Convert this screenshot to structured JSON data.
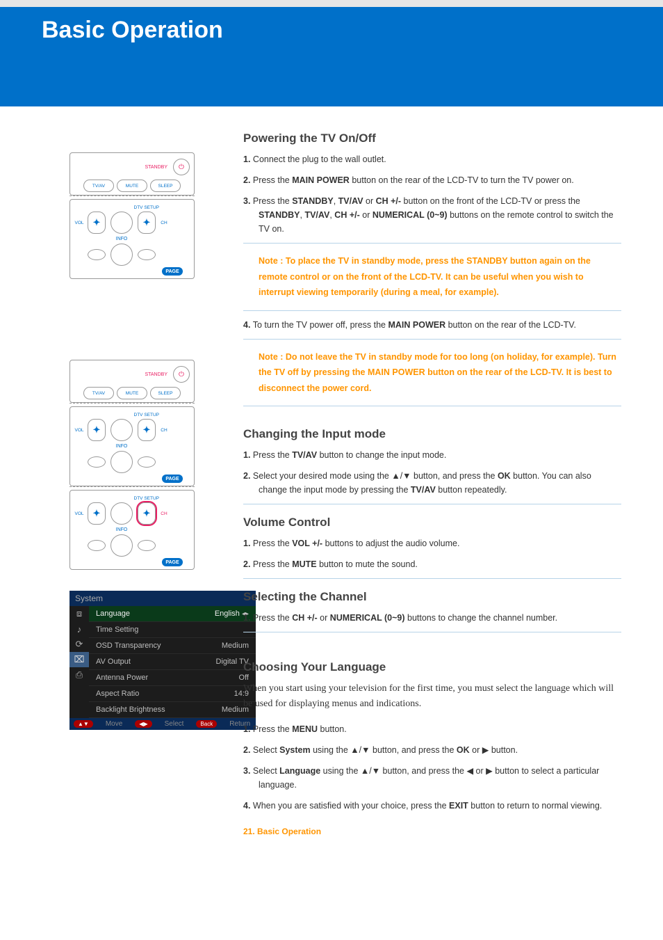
{
  "banner": {
    "title": "Basic Operation"
  },
  "remote": {
    "standby": "STANDBY",
    "tvav": "TV/AV",
    "mute": "MUTE",
    "sleep": "SLEEP",
    "dtv_setup": "DTV SETUP",
    "vol": "VOL",
    "ch": "CH",
    "info": "INFO",
    "page": "PAGE"
  },
  "sections": {
    "power": {
      "title": "Powering the TV On/Off",
      "s1": "Connect the plug to the wall outlet.",
      "s2a": "Press the ",
      "s2b": "MAIN POWER",
      "s2c": " button on the rear of the LCD-TV to turn the TV power on.",
      "s3a": "Press the ",
      "s3b": "STANDBY",
      "s3c": ", ",
      "s3d": "TV/AV",
      "s3e": " or ",
      "s3f": "CH +/-",
      "s3g": " button on the front of the LCD-TV or press the ",
      "s3h": "STANDBY",
      "s3i": ", ",
      "s3j": "TV/AV",
      "s3k": ", ",
      "s3l": "CH +/-",
      "s3m": " or ",
      "s3n": "NUMERICAL (0~9)",
      "s3o": " buttons on the remote control to switch the TV on.",
      "note1a": "Note : To place the TV in standby mode, press the ",
      "note1b": "STANDBY",
      "note1c": " button again on the remote control or on the front of the LCD-TV. It can be useful when you wish to interrupt viewing temporarily (during a meal, for example).",
      "s4a": "To turn the TV power off, press the ",
      "s4b": "MAIN POWER",
      "s4c": " button on the rear of the LCD-TV.",
      "note2a": "Note : Do not leave the TV in standby mode for too long (on holiday, for example). Turn the TV off by pressing the ",
      "note2b": "MAIN POWER",
      "note2c": " button on the rear of the LCD-TV. It is best to disconnect the power cord."
    },
    "input": {
      "title": "Changing the Input mode",
      "s1a": "Press the ",
      "s1b": "TV/AV",
      "s1c": " button to change the input mode.",
      "s2a": "Select your desired mode using the ▲/▼ button, and press the ",
      "s2b": "OK",
      "s2c": " button. You can also change the input mode by pressing the ",
      "s2d": "TV/AV",
      "s2e": " button repeatedly."
    },
    "volume": {
      "title": "Volume Control",
      "s1a": "Press the ",
      "s1b": "VOL +/-",
      "s1c": " buttons to adjust the audio volume.",
      "s2a": "Press the ",
      "s2b": "MUTE",
      "s2c": " button to mute the sound."
    },
    "channel": {
      "title": "Selecting the Channel",
      "s1a": "Press the ",
      "s1b": "CH +/-",
      "s1c": " or ",
      "s1d": "NUMERICAL (0~9)",
      "s1e": " buttons to change the channel number."
    },
    "language": {
      "title": "Choosing Your Language",
      "intro": "When you start using your television for the first time,  you must select the language which will be used for displaying menus and indications.",
      "s1a": "Press the ",
      "s1b": "MENU",
      "s1c": " button.",
      "s2a": "Select ",
      "s2b": "System",
      "s2c": " using the ▲/▼ button, and press the ",
      "s2d": "OK",
      "s2e": " or ▶ button.",
      "s3a": "Select ",
      "s3b": "Language",
      "s3c": " using the ▲/▼ button, and press the ◀ or ▶ button to select a particular language.",
      "s4a": "When you are satisfied with your choice, press the ",
      "s4b": "EXIT",
      "s4c": " button to return to normal viewing."
    }
  },
  "osd": {
    "header": "System",
    "rows": [
      {
        "label": "Language",
        "value": "English",
        "active": true,
        "arrows": true
      },
      {
        "label": "Time Setting",
        "value": ""
      },
      {
        "label": "OSD Transparency",
        "value": "Medium"
      },
      {
        "label": "AV Output",
        "value": "Digital TV"
      },
      {
        "label": "Antenna Power",
        "value": "Off"
      },
      {
        "label": "Aspect Ratio",
        "value": "14:9"
      },
      {
        "label": "Backlight Brightness",
        "value": "Medium"
      }
    ],
    "footer": {
      "move": "Move",
      "select": "Select",
      "back": "Back",
      "return": "Return"
    }
  },
  "footer": "21. Basic Operation"
}
